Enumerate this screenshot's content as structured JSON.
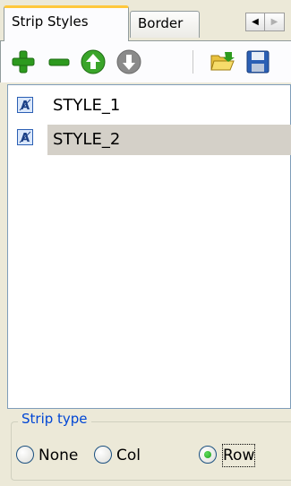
{
  "tabs": [
    {
      "label": "Strip Styles",
      "active": true
    },
    {
      "label": "Border",
      "active": false
    }
  ],
  "tab_scroll": {
    "left_icon": "arrow-left-icon",
    "right_icon": "arrow-right-icon"
  },
  "toolbar": {
    "buttons": [
      "add-icon",
      "remove-icon",
      "move-up-icon",
      "move-down-icon",
      "open-folder-icon",
      "save-icon"
    ]
  },
  "list": {
    "items": [
      {
        "label": "STYLE_1",
        "icon": "style-icon",
        "selected": false
      },
      {
        "label": "STYLE_2",
        "icon": "style-icon",
        "selected": true
      }
    ]
  },
  "strip_type": {
    "legend": "Strip type",
    "options": [
      {
        "label": "None",
        "checked": false
      },
      {
        "label": "Col",
        "checked": false
      },
      {
        "label": "Row",
        "checked": true
      }
    ]
  },
  "colors": {
    "accent": "#ffc83c",
    "legend": "#0046d5",
    "selection": "#d4d0c8"
  }
}
